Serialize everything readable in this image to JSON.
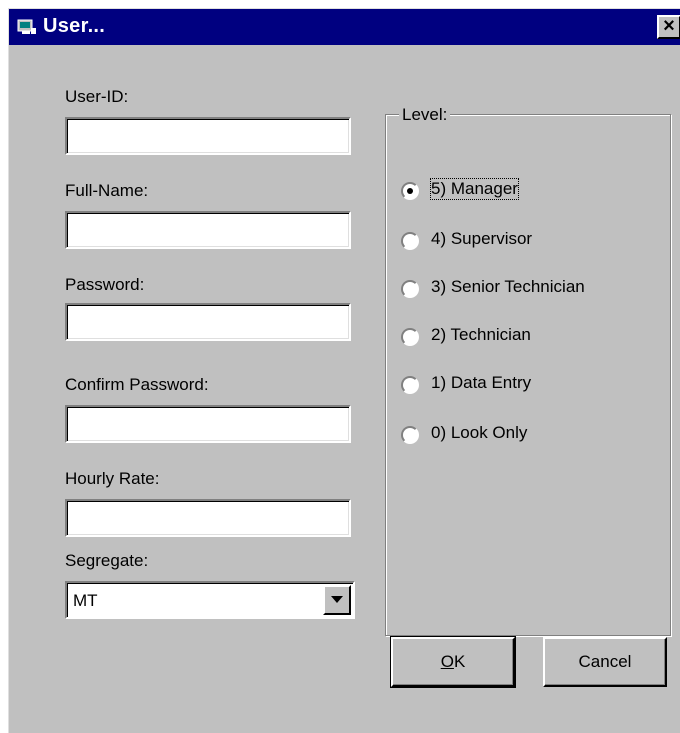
{
  "window": {
    "title": "User...",
    "close_glyph": "×"
  },
  "form": {
    "user_id": {
      "label": "User-ID:",
      "value": ""
    },
    "full_name": {
      "label": "Full-Name:",
      "value": ""
    },
    "password": {
      "label": "Password:",
      "value": ""
    },
    "confirm_password": {
      "label": "Confirm Password:",
      "value": ""
    },
    "hourly_rate": {
      "label": "Hourly Rate:",
      "value": ""
    },
    "segregate": {
      "label": "Segregate:",
      "value": "MT"
    }
  },
  "level": {
    "legend": "Level:",
    "selected_index": 0,
    "options": [
      {
        "label": "5) Manager"
      },
      {
        "label": "4) Supervisor"
      },
      {
        "label": "3) Senior Technician"
      },
      {
        "label": "2) Technician"
      },
      {
        "label": "1) Data Entry"
      },
      {
        "label": "0) Look Only"
      }
    ]
  },
  "buttons": {
    "ok_label_mnemonic": "O",
    "ok_label_rest": "K",
    "cancel_label": "Cancel"
  },
  "colors": {
    "titlebar": "#000080",
    "face": "#c0c0c0"
  }
}
